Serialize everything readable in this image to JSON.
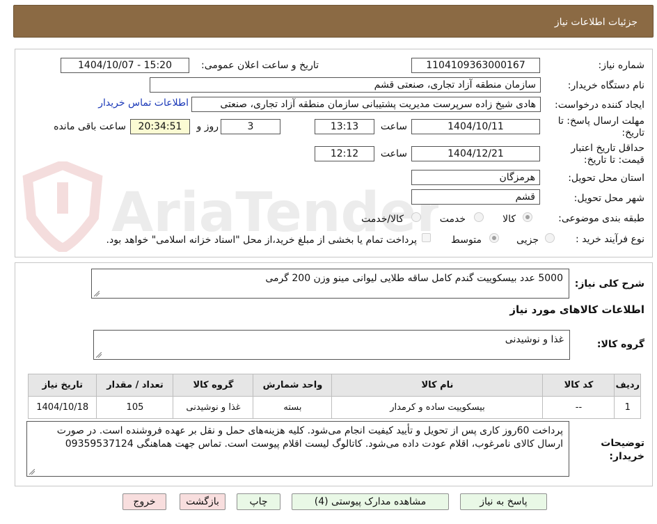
{
  "header": {
    "title": "جزئیات اطلاعات نیاز"
  },
  "fields": {
    "need_number_label": "شماره نیاز:",
    "need_number": "1104109363000167",
    "announce_label": "تاریخ و ساعت اعلان عمومی:",
    "announce_value": "1404/10/07 - 15:20",
    "buyer_org_label": "نام دستگاه خریدار:",
    "buyer_org": "سازمان منطقه آزاد تجاری، صنعتی قشم",
    "creator_label": "ایجاد کننده درخواست:",
    "creator": "هادی شیخ زاده سرپرست مدیریت پشتیبانی سازمان منطقه آزاد تجاری، صنعتی",
    "contact_link": "اطلاعات تماس خریدار",
    "deadline_label": "مهلت ارسال پاسخ: تا تاریخ:",
    "deadline_date": "1404/10/11",
    "time_label": "ساعت",
    "deadline_time": "13:13",
    "days_value": "3",
    "days_label": "روز و",
    "remaining_time": "20:34:51",
    "remaining_label": "ساعت باقی مانده",
    "validity_label": "حداقل تاریخ اعتبار قیمت: تا تاریخ:",
    "validity_date": "1404/12/21",
    "validity_time": "12:12",
    "province_label": "استان محل تحویل:",
    "province": "هرمزگان",
    "city_label": "شهر محل تحویل:",
    "city": "قشم",
    "category_label": "طبقه بندی موضوعی:",
    "category_options": [
      "کالا",
      "خدمت",
      "کالا/خدمت"
    ],
    "purchase_type_label": "نوع فرآیند خرید :",
    "purchase_options": [
      "جزیی",
      "متوسط"
    ],
    "purchase_note": "پرداخت تمام یا بخشی از مبلغ خرید،از محل \"اسناد خزانه اسلامی\" خواهد بود."
  },
  "summary": {
    "label": "شرح کلی نیاز:",
    "text": "5000 عدد بیسکوییت گندم کامل ساقه طلایی لیوانی  مینو وزن 200 گرمی"
  },
  "goods": {
    "section_title": "اطلاعات کالاهای مورد نیاز",
    "group_label": "گروه کالا:",
    "group_value": "غذا و نوشیدنی",
    "columns": [
      "ردیف",
      "کد کالا",
      "نام کالا",
      "واحد شمارش",
      "گروه کالا",
      "تعداد / مقدار",
      "تاریخ نیاز"
    ],
    "rows": [
      [
        "1",
        "--",
        "بیسکوییت ساده و کرمدار",
        "بسته",
        "غذا و نوشیدنی",
        "105",
        "1404/10/18"
      ]
    ]
  },
  "buyer_notes": {
    "label": "توضیحات خریدار:",
    "text": "پرداخت 60روز کاری پس از تحویل و تأیید کیفیت انجام می‌شود. کلیه هزینه‌های حمل و نقل بر عهده فروشنده است. در صورت ارسال کالای نامرغوب، اقلام عودت داده می‌شود. کاتالوگ لیست اقلام  پیوست است. تماس جهت هماهنگی 09359537124"
  },
  "buttons": {
    "reply": "پاسخ به نیاز",
    "documents": "مشاهده مدارک پیوستی (4)",
    "print": "چاپ",
    "back": "بازگشت",
    "exit": "خروج"
  },
  "watermark": {
    "text": "AriaTender.neT"
  }
}
